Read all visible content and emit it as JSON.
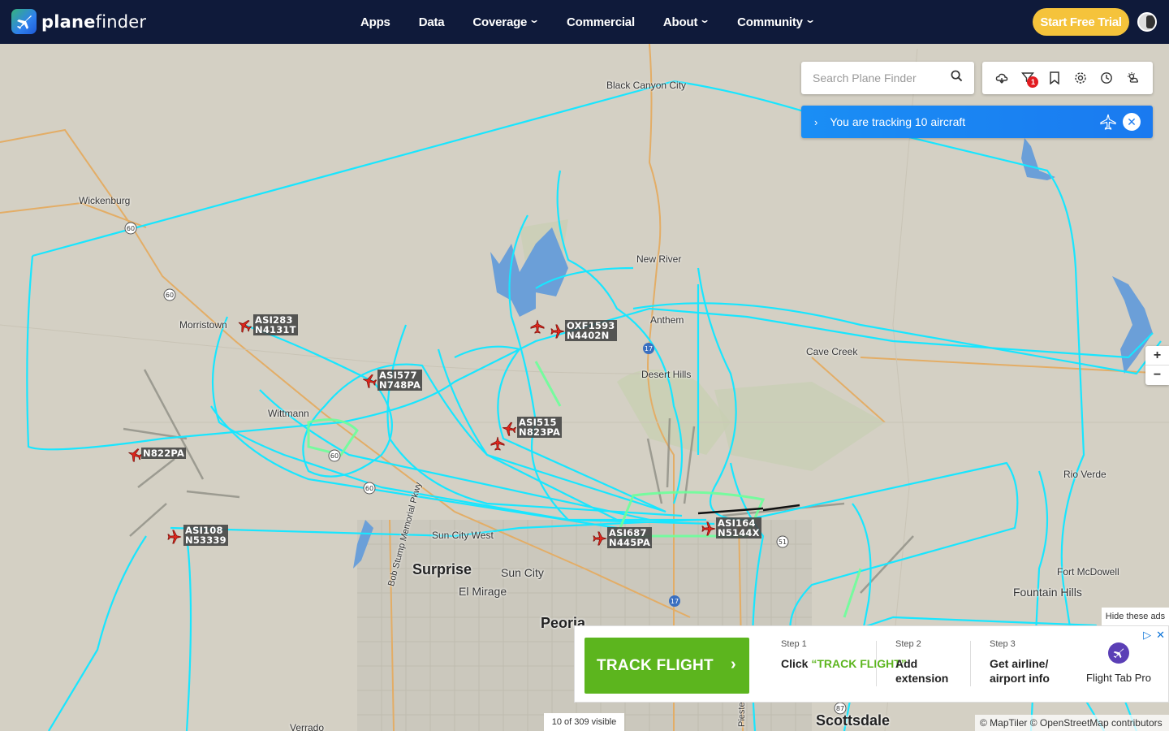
{
  "brand": {
    "name_bold": "plane",
    "name_light": "finder"
  },
  "nav": [
    {
      "label": "Apps",
      "dropdown": false
    },
    {
      "label": "Data",
      "dropdown": false
    },
    {
      "label": "Coverage",
      "dropdown": true
    },
    {
      "label": "Commercial",
      "dropdown": false
    },
    {
      "label": "About",
      "dropdown": true
    },
    {
      "label": "Community",
      "dropdown": true
    }
  ],
  "header": {
    "trial_label": "Start Free Trial"
  },
  "search": {
    "placeholder": "Search Plane Finder"
  },
  "toolbar": {
    "icons": [
      "cloud-layer-icon",
      "filter-icon",
      "bookmark-icon",
      "settings-icon",
      "history-icon",
      "weather-icon"
    ],
    "filter_badge": "1"
  },
  "tracking": {
    "text": "You are tracking 10 aircraft"
  },
  "zoom": {
    "in": "+",
    "out": "−"
  },
  "places": [
    {
      "name": "Black Canyon City",
      "size": ""
    },
    {
      "name": "Wickenburg",
      "size": ""
    },
    {
      "name": "New River",
      "size": ""
    },
    {
      "name": "Morristown",
      "size": ""
    },
    {
      "name": "Anthem",
      "size": ""
    },
    {
      "name": "Desert Hills",
      "size": ""
    },
    {
      "name": "Cave Creek",
      "size": ""
    },
    {
      "name": "Wittmann",
      "size": ""
    },
    {
      "name": "Rio Verde",
      "size": ""
    },
    {
      "name": "Sun City West",
      "size": ""
    },
    {
      "name": "Surprise",
      "size": "big"
    },
    {
      "name": "Sun City",
      "size": "med"
    },
    {
      "name": "El Mirage",
      "size": "med"
    },
    {
      "name": "Peoria",
      "size": "big"
    },
    {
      "name": "Fort McDowell",
      "size": ""
    },
    {
      "name": "Fountain Hills",
      "size": "med"
    },
    {
      "name": "Scottsdale",
      "size": "big"
    },
    {
      "name": "Verrado",
      "size": ""
    },
    {
      "name": "Bob Stump Memorial Pkwy",
      "size": ""
    },
    {
      "name": "Piestewa Fwy",
      "size": ""
    }
  ],
  "aircraft": [
    {
      "callsign": "ASI283",
      "reg": "N4131T"
    },
    {
      "callsign": "ASI577",
      "reg": "N748PA"
    },
    {
      "callsign": "OXF1593",
      "reg": "N4402N"
    },
    {
      "callsign": "ASI515",
      "reg": "N823PA"
    },
    {
      "callsign": "",
      "reg": "N822PA"
    },
    {
      "callsign": "ASI108",
      "reg": "N53339"
    },
    {
      "callsign": "ASI687",
      "reg": "N445PA"
    },
    {
      "callsign": "ASI164",
      "reg": "N5144X"
    }
  ],
  "ad": {
    "hide_label": "Hide these ads",
    "button_label": "TRACK FLIGHT",
    "steps": [
      {
        "label": "Step 1",
        "pre": "Click ",
        "highlight": "“TRACK FLIGHT”"
      },
      {
        "label": "Step 2",
        "text": "Add extension"
      },
      {
        "label": "Step 3",
        "text": "Get airline/ airport info"
      }
    ],
    "brand_name": "Flight Tab Pro"
  },
  "status": {
    "visible_count": "10 of 309 visible"
  },
  "attribution": "© MapTiler © OpenStreetMap contributors",
  "colors": {
    "nav_bg": "#0f1a3a",
    "trial": "#f5c33b",
    "track": "#18e6ff",
    "track_green": "#6cff9a",
    "tracking_banner": "#1a7af0",
    "ad_green": "#5cb51e"
  }
}
